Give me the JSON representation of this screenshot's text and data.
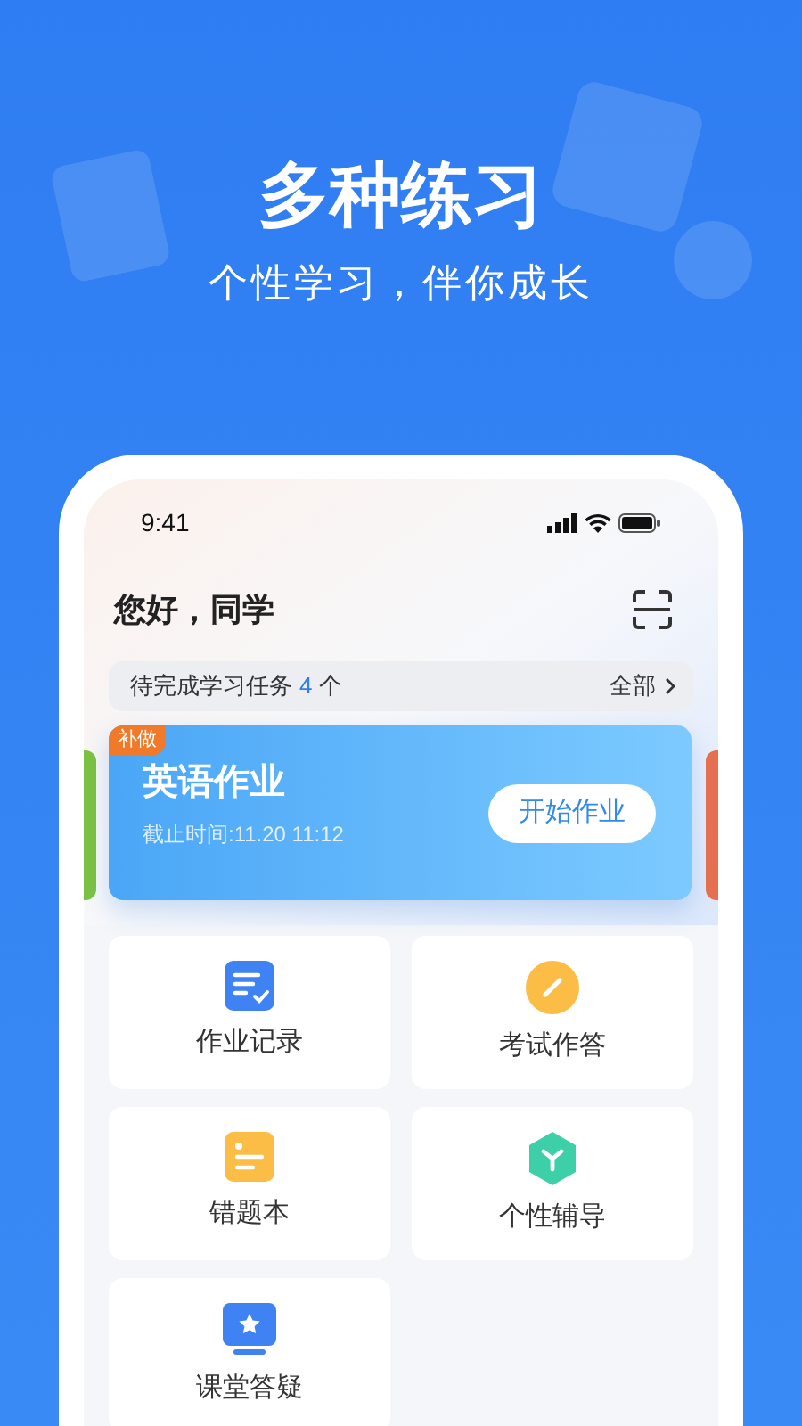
{
  "header": {
    "title": "多种练习",
    "subtitle": "个性学习，伴你成长"
  },
  "phone": {
    "status_bar": {
      "time": "9:41"
    },
    "greeting": "您好，同学",
    "tasks": {
      "label": "待完成学习任务",
      "count": "4",
      "unit": "个",
      "link": "全部"
    },
    "side_cards": [
      {
        "color": "#7cc242"
      },
      {
        "color": "#e8704f"
      }
    ],
    "assignment": {
      "badge": "补做",
      "title": "英语作业",
      "deadline": "截止时间:11.20 11:12",
      "button": "开始作业"
    },
    "features": [
      {
        "kind": "record",
        "label": "作业记录"
      },
      {
        "kind": "exam",
        "label": "考试作答"
      },
      {
        "kind": "mistakes",
        "label": "错题本"
      },
      {
        "kind": "tutoring",
        "label": "个性辅导"
      },
      {
        "kind": "qa",
        "label": "课堂答疑"
      }
    ]
  }
}
